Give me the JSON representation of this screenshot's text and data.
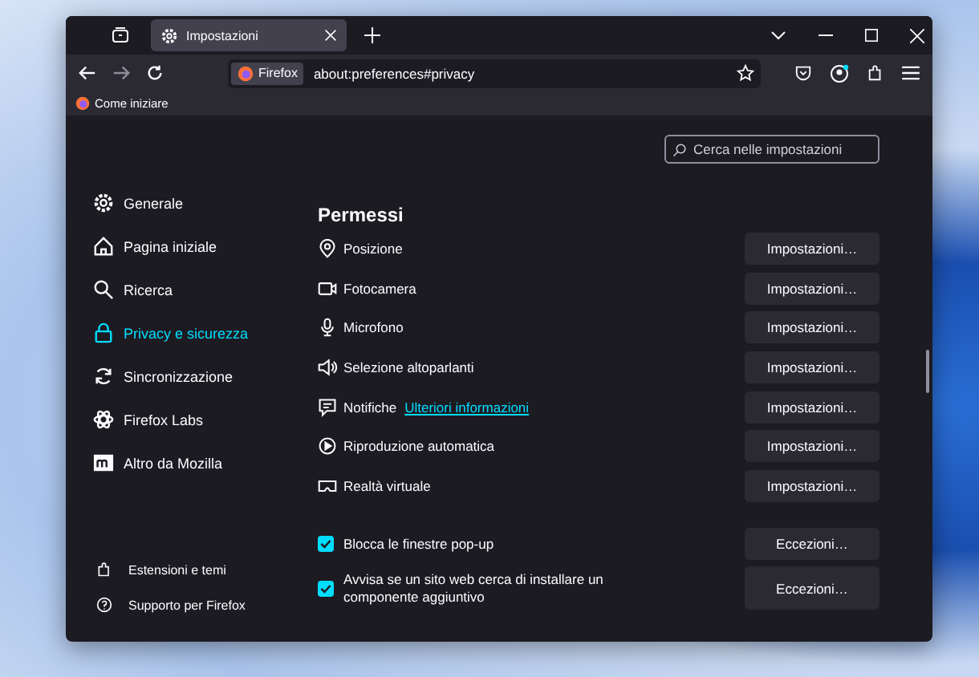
{
  "tab": {
    "title": "Impostazioni"
  },
  "address_bar": {
    "identity": "Firefox",
    "url": "about:preferences#privacy"
  },
  "bookmarks": [
    {
      "label": "Come iniziare"
    }
  ],
  "search": {
    "placeholder": "Cerca nelle impostazioni"
  },
  "sidebar": {
    "items": [
      {
        "label": "Generale",
        "selected": false
      },
      {
        "label": "Pagina iniziale",
        "selected": false
      },
      {
        "label": "Ricerca",
        "selected": false
      },
      {
        "label": "Privacy e sicurezza",
        "selected": true
      },
      {
        "label": "Sincronizzazione",
        "selected": false
      },
      {
        "label": "Firefox Labs",
        "selected": false
      },
      {
        "label": "Altro da Mozilla",
        "selected": false
      }
    ],
    "footer": [
      {
        "label": "Estensioni e temi"
      },
      {
        "label": "Supporto per Firefox"
      }
    ]
  },
  "permissions": {
    "title": "Permessi",
    "rows": [
      {
        "label": "Posizione",
        "button": "Impostazioni…"
      },
      {
        "label": "Fotocamera",
        "button": "Impostazioni…"
      },
      {
        "label": "Microfono",
        "button": "Impostazioni…"
      },
      {
        "label": "Selezione altoparlanti",
        "button": "Impostazioni…"
      },
      {
        "label": "Notifiche",
        "link": "Ulteriori informazioni",
        "button": "Impostazioni…"
      },
      {
        "label": "Riproduzione automatica",
        "button": "Impostazioni…"
      },
      {
        "label": "Realtà virtuale",
        "button": "Impostazioni…"
      }
    ]
  },
  "options": [
    {
      "label": "Blocca le finestre pop-up",
      "checked": true,
      "button": "Eccezioni…"
    },
    {
      "label": "Avvisa se un sito web cerca di installare un componente aggiuntivo",
      "checked": true,
      "button": "Eccezioni…"
    }
  ]
}
